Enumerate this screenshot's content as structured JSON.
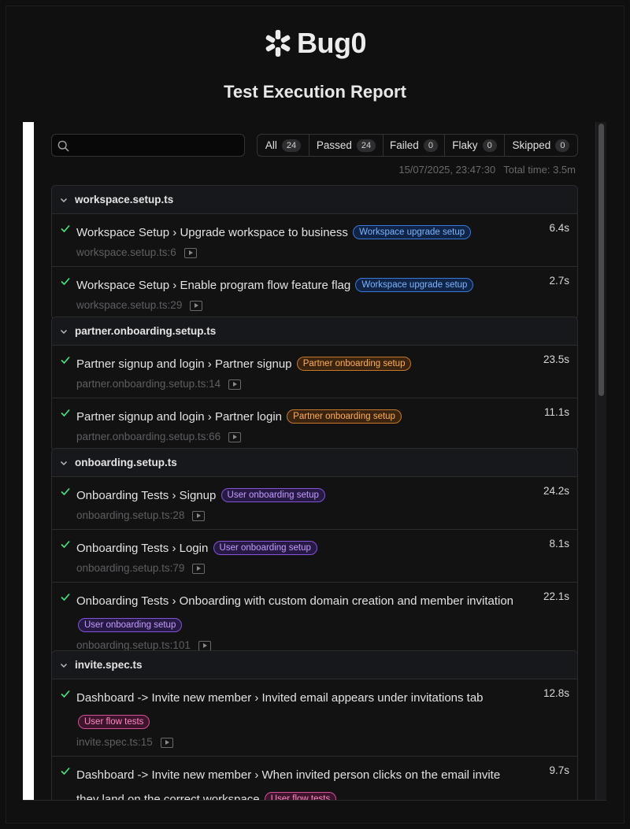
{
  "brand": {
    "name": "Bug0"
  },
  "report": {
    "title": "Test Execution Report"
  },
  "search": {
    "placeholder": "",
    "value": ""
  },
  "filters": [
    {
      "label": "All",
      "count": "24"
    },
    {
      "label": "Passed",
      "count": "24"
    },
    {
      "label": "Failed",
      "count": "0"
    },
    {
      "label": "Flaky",
      "count": "0"
    },
    {
      "label": "Skipped",
      "count": "0"
    }
  ],
  "meta": {
    "timestamp": "15/07/2025, 23:47:30",
    "total_time": "Total time: 3.5m"
  },
  "colors": {
    "pass": "#4ade80",
    "tag_blue": "#7eb4ff",
    "tag_orange": "#ffae57",
    "tag_purple": "#c69cff",
    "tag_pink": "#ff8ac4"
  },
  "groups": [
    {
      "file": "workspace.setup.ts",
      "tests": [
        {
          "title": "Workspace Setup › Upgrade workspace to business",
          "tag": "Workspace upgrade setup",
          "location": "workspace.setup.ts:6",
          "duration": "6.4s"
        },
        {
          "title": "Workspace Setup › Enable program flow feature flag",
          "tag": "Workspace upgrade setup",
          "location": "workspace.setup.ts:29",
          "duration": "2.7s"
        }
      ]
    },
    {
      "file": "partner.onboarding.setup.ts",
      "tests": [
        {
          "title": "Partner signup and login › Partner signup",
          "tag": "Partner onboarding setup",
          "location": "partner.onboarding.setup.ts:14",
          "duration": "23.5s"
        },
        {
          "title": "Partner signup and login › Partner login",
          "tag": "Partner onboarding setup",
          "location": "partner.onboarding.setup.ts:66",
          "duration": "11.1s"
        }
      ]
    },
    {
      "file": "onboarding.setup.ts",
      "tests": [
        {
          "title": "Onboarding Tests › Signup",
          "tag": "User onboarding setup",
          "location": "onboarding.setup.ts:28",
          "duration": "24.2s"
        },
        {
          "title": "Onboarding Tests › Login",
          "tag": "User onboarding setup",
          "location": "onboarding.setup.ts:79",
          "duration": "8.1s"
        },
        {
          "title": "Onboarding Tests › Onboarding with custom domain creation and member invitation",
          "tag": "User onboarding setup",
          "location": "onboarding.setup.ts:101",
          "duration": "22.1s"
        }
      ]
    },
    {
      "file": "invite.spec.ts",
      "tests": [
        {
          "title": "Dashboard -> Invite new member › Invited email appears under invitations tab",
          "tag": "User flow tests",
          "location": "invite.spec.ts:15",
          "duration": "12.8s"
        },
        {
          "title": "Dashboard -> Invite new member › When invited person clicks on the email invite they land on the correct workspace",
          "tag": "User flow tests",
          "location": "",
          "duration": "9.7s"
        }
      ]
    }
  ]
}
